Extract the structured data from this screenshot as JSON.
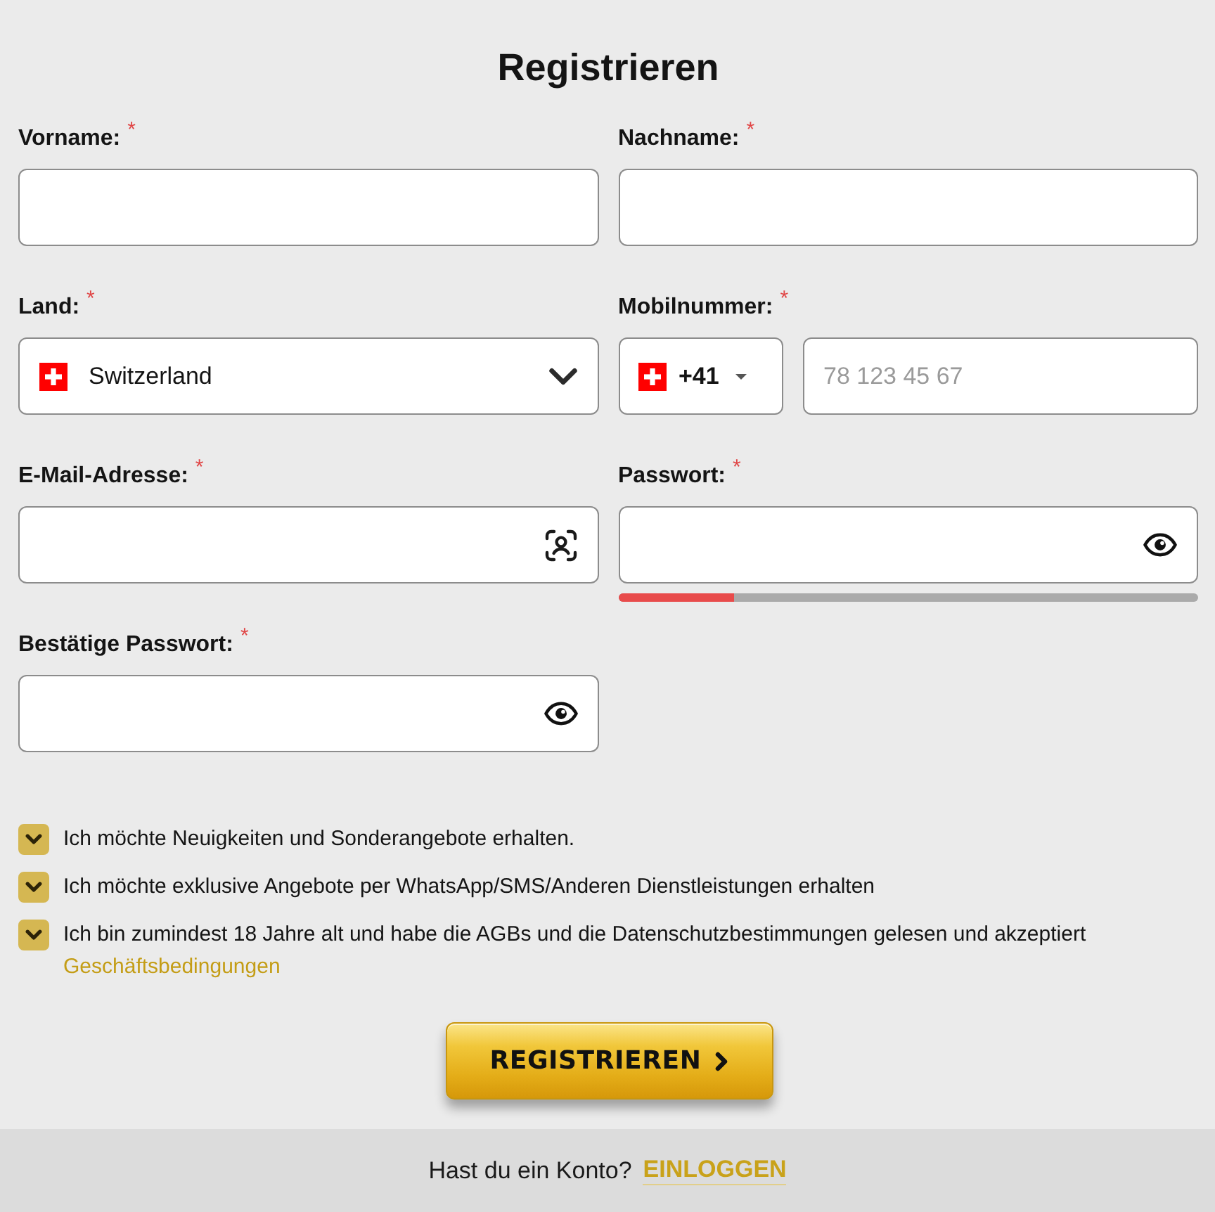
{
  "title": "Registrieren",
  "fields": [
    {
      "kind": "text",
      "label": "Vorname:",
      "required_mark": "*"
    },
    {
      "kind": "text",
      "label": "Nachname:",
      "required_mark": "*"
    },
    {
      "kind": "country",
      "label": "Land:",
      "required_mark": "*",
      "value": "Switzerland"
    },
    {
      "kind": "phone",
      "label": "Mobilnummer:",
      "required_mark": "*",
      "dial_code": "+41",
      "placeholder": "78 123 45 67"
    },
    {
      "kind": "email",
      "label": "E-Mail-Adresse:",
      "required_mark": "*"
    },
    {
      "kind": "password",
      "label": "Passwort:",
      "required_mark": "*",
      "strength": {
        "level": 0.2
      }
    },
    {
      "kind": "password",
      "label": "Bestätige Passwort:",
      "required_mark": "*"
    }
  ],
  "consents": [
    {
      "text": "Ich möchte Neuigkeiten und Sonderangebote erhalten.",
      "checked": true
    },
    {
      "text": "Ich möchte exklusive Angebote per WhatsApp/SMS/Anderen Dienstleistungen erhalten",
      "checked": true
    },
    {
      "text": "Ich bin zumindest 18 Jahre alt und habe die AGBs und die Datenschutzbestimmungen gelesen und akzeptiert",
      "checked": true,
      "link": "Geschäftsbedingungen"
    }
  ],
  "submit": {
    "label": "REGISTRIEREN"
  },
  "footer": {
    "text": "Hast du ein Konto?",
    "link": "EINLOGGEN"
  }
}
